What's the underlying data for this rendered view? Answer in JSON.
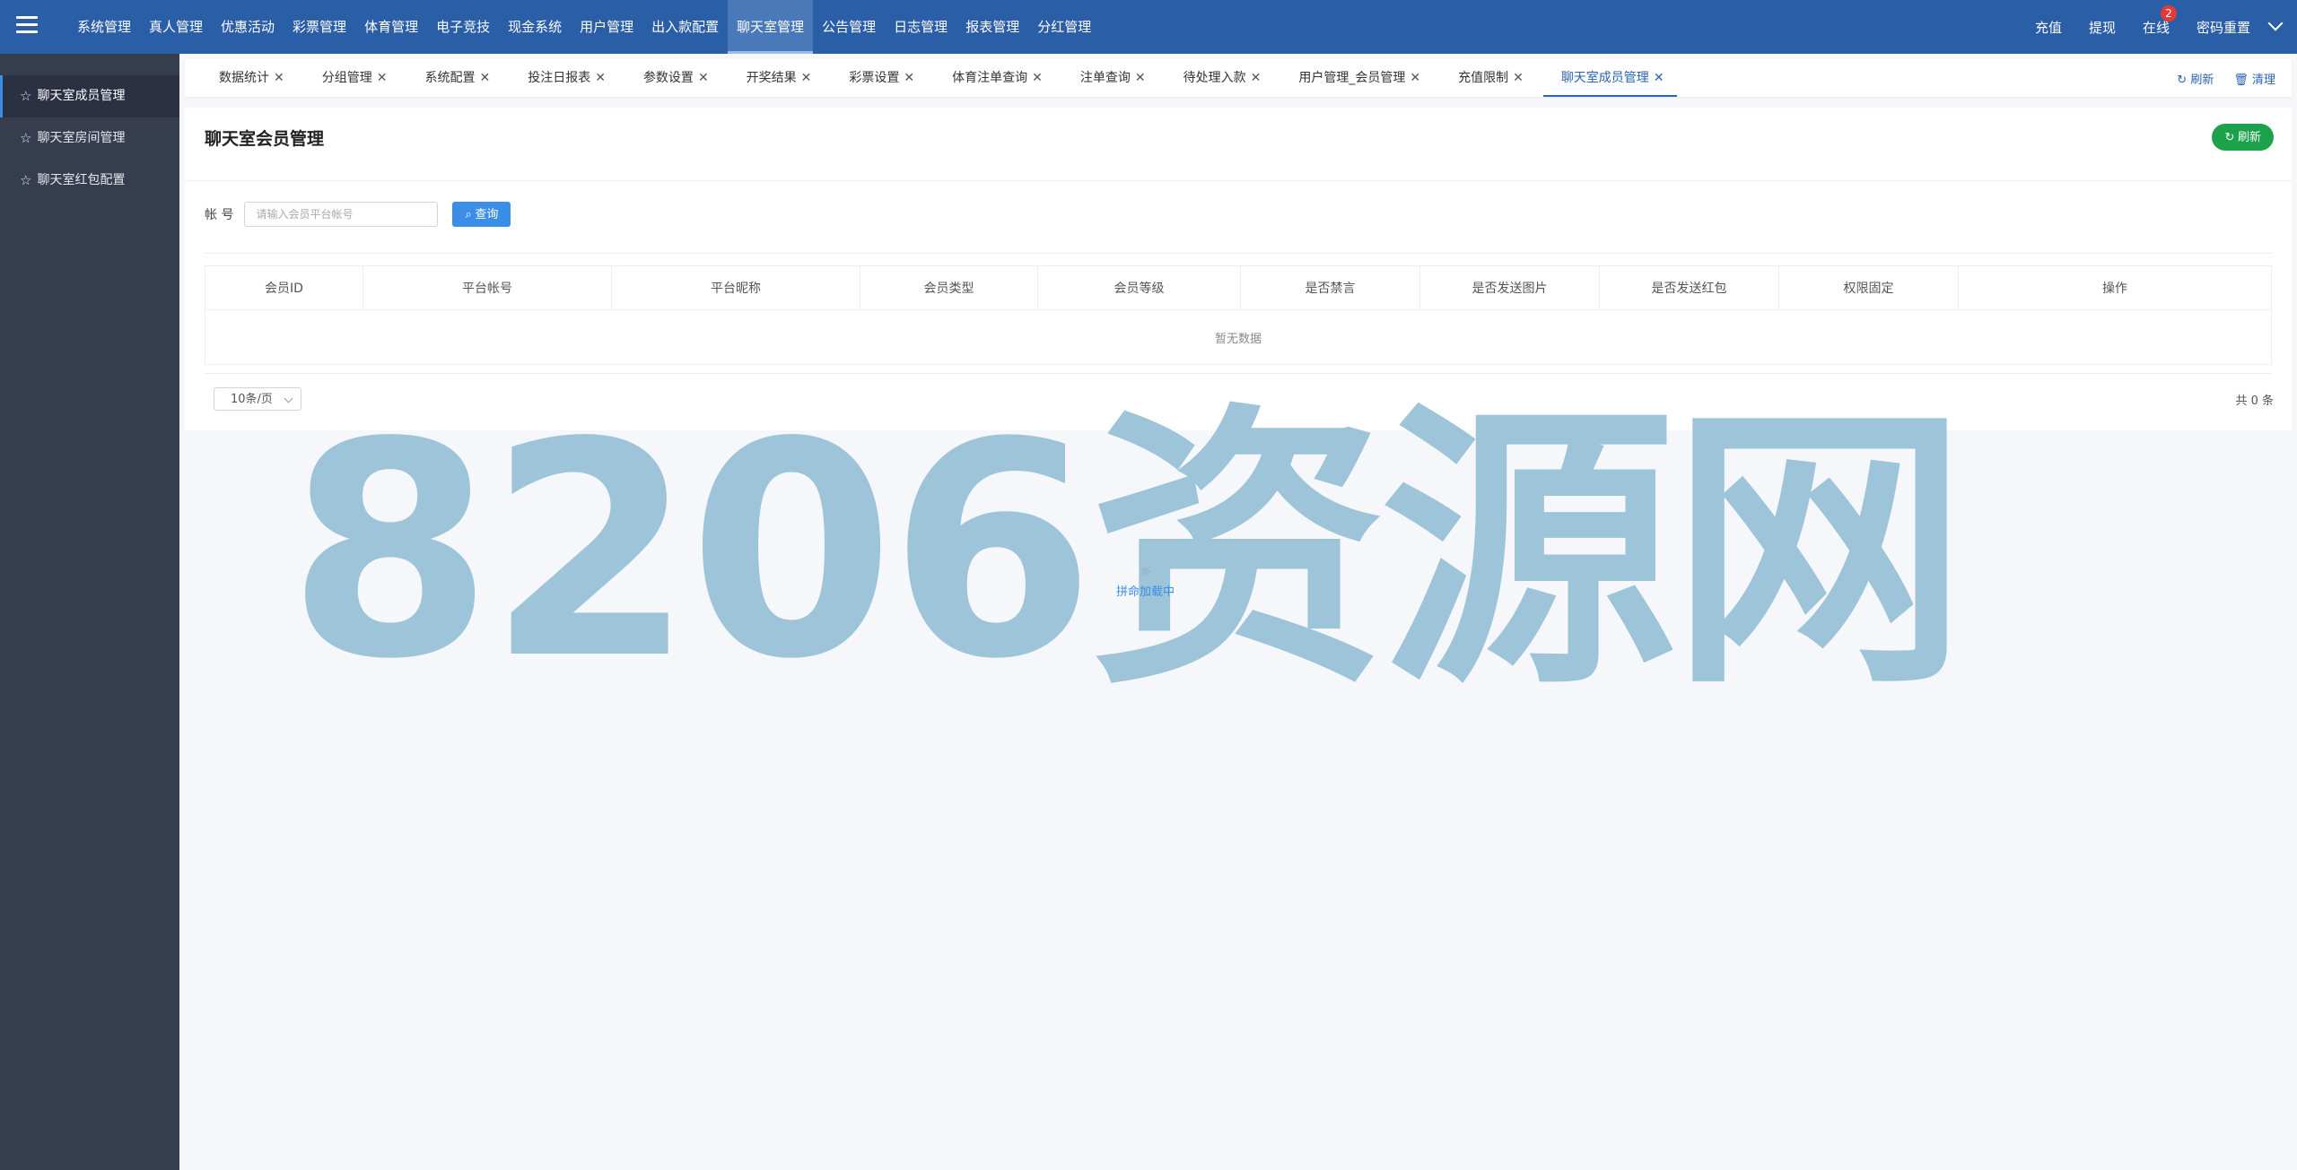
{
  "topnav": {
    "items": [
      {
        "label": "系统管理"
      },
      {
        "label": "真人管理"
      },
      {
        "label": "优惠活动"
      },
      {
        "label": "彩票管理"
      },
      {
        "label": "体育管理"
      },
      {
        "label": "电子竞技"
      },
      {
        "label": "现金系统"
      },
      {
        "label": "用户管理"
      },
      {
        "label": "出入款配置"
      },
      {
        "label": "聊天室管理"
      },
      {
        "label": "公告管理"
      },
      {
        "label": "日志管理"
      },
      {
        "label": "报表管理"
      },
      {
        "label": "分红管理"
      }
    ],
    "active_index": 9,
    "right": {
      "recharge": "充值",
      "withdraw": "提现",
      "online": "在线",
      "online_count": "2",
      "user": "密码重置"
    }
  },
  "sidebar": {
    "items": [
      {
        "label": "聊天室成员管理"
      },
      {
        "label": "聊天室房间管理"
      },
      {
        "label": "聊天室红包配置"
      }
    ]
  },
  "tabs": {
    "items": [
      {
        "label": "数据统计"
      },
      {
        "label": "分组管理"
      },
      {
        "label": "系统配置"
      },
      {
        "label": "投注日报表"
      },
      {
        "label": "参数设置"
      },
      {
        "label": "开奖结果"
      },
      {
        "label": "彩票设置"
      },
      {
        "label": "体育注单查询"
      },
      {
        "label": "注单查询"
      },
      {
        "label": "待处理入款"
      },
      {
        "label": "用户管理_会员管理"
      },
      {
        "label": "充值限制"
      },
      {
        "label": "聊天室成员管理"
      }
    ],
    "close_glyph": "✕",
    "actions": {
      "refresh": "刷新",
      "clear": "清理"
    }
  },
  "page": {
    "title": "聊天室会员管理",
    "refresh_label": "刷新",
    "search": {
      "label": "帐 号",
      "placeholder": "请输入会员平台帐号",
      "value": "",
      "query_label": "查询"
    },
    "table": {
      "columns": [
        "会员ID",
        "平台帐号",
        "平台昵称",
        "会员类型",
        "会员等级",
        "是否禁言",
        "是否发送图片",
        "是否发送红包",
        "权限固定",
        "操作"
      ],
      "empty_text": "暂无数据"
    },
    "pager": {
      "page_size": "10条/页",
      "total": "共 0 条"
    },
    "loading_text": "拼命加载中"
  },
  "watermark": "8206资源网",
  "colors": {
    "topbar": "#2a5ea7",
    "sidebar": "#363d4f",
    "primary": "#3b8ee8",
    "success": "#1ca34a"
  }
}
